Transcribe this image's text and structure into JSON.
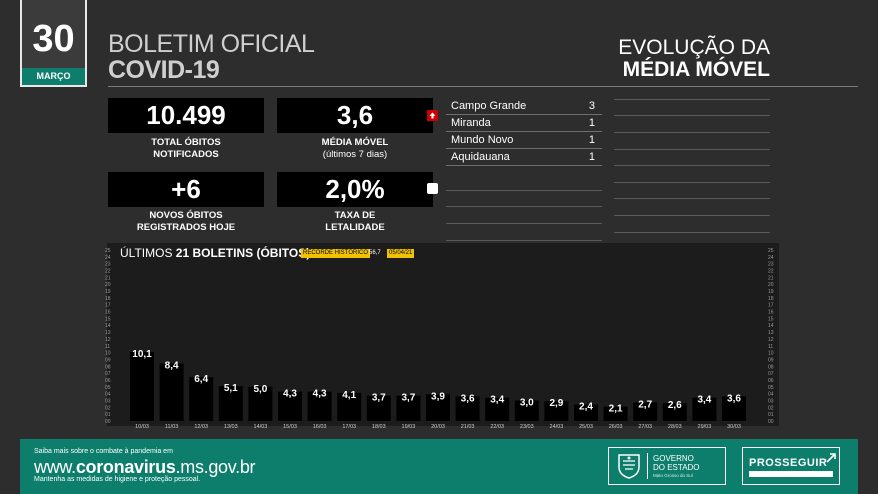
{
  "header": {
    "day": "30",
    "month": "MARÇO",
    "title_line1": "BOLETIM OFICIAL",
    "title_line2": "COVID-19",
    "section_line1": "EVOLUÇÃO DA",
    "section_line2": "MÉDIA MÓVEL"
  },
  "stats": {
    "total_deaths": {
      "value": "10.499",
      "label_line1": "TOTAL ÓBITOS",
      "label_line2": "NOTIFICADOS"
    },
    "moving_average": {
      "value": "3,6",
      "label_line1": "MÉDIA MÓVEL",
      "label_line2": "(últimos 7 dias)"
    },
    "new_deaths": {
      "value": "+6",
      "label_line1": "NOVOS ÓBITOS",
      "label_line2": "REGISTRADOS HOJE"
    },
    "lethality": {
      "value": "2,0%",
      "label_line1": "TAXA DE",
      "label_line2": "LETALIDADE"
    }
  },
  "cities": [
    {
      "name": "Campo Grande",
      "value": "3"
    },
    {
      "name": "Miranda",
      "value": "1"
    },
    {
      "name": "Mundo Novo",
      "value": "1"
    },
    {
      "name": "Aquidauana",
      "value": "1"
    }
  ],
  "chart_title": {
    "prefix": "ÚLTIMOS ",
    "bold": "21 BOLETINS (ÓBITOS)"
  },
  "legend": {
    "record_label": "RECORDE HISTÓRICO",
    "record_value": "56,7",
    "record_date": "05/04/21"
  },
  "chart_data": {
    "type": "bar",
    "categories": [
      "10/03",
      "11/03",
      "12/03",
      "13/03",
      "14/03",
      "15/03",
      "16/03",
      "17/03",
      "18/03",
      "19/03",
      "20/03",
      "21/03",
      "22/03",
      "23/03",
      "24/03",
      "25/03",
      "26/03",
      "27/03",
      "28/03",
      "29/03",
      "30/03"
    ],
    "values": [
      10.1,
      8.4,
      6.4,
      5.1,
      5.0,
      4.3,
      4.3,
      4.1,
      3.7,
      3.7,
      3.9,
      3.6,
      3.4,
      3.0,
      2.9,
      2.4,
      2.1,
      2.7,
      2.6,
      3.4,
      3.6
    ],
    "value_labels": [
      "10,1",
      "8,4",
      "6,4",
      "5,1",
      "5,0",
      "4,3",
      "4,3",
      "4,1",
      "3,7",
      "3,7",
      "3,9",
      "3,6",
      "3,4",
      "3,0",
      "2,9",
      "2,4",
      "2,1",
      "2,7",
      "2,6",
      "3,4",
      "3,6"
    ],
    "ylim": [
      0,
      25
    ],
    "yticks": [
      "00",
      "01",
      "02",
      "03",
      "04",
      "05",
      "06",
      "07",
      "08",
      "09",
      "10",
      "11",
      "12",
      "13",
      "14",
      "15",
      "16",
      "17",
      "18",
      "19",
      "20",
      "21",
      "22",
      "23",
      "24",
      "25"
    ],
    "bar_color": "#000000",
    "background": "#1c1c1c"
  },
  "footer": {
    "line1": "Saiba mais sobre o combate à pandemia em",
    "url_prefix": "www.",
    "url_bold": "coronavirus",
    "url_suffix": ".ms.gov.br",
    "line3": "Mantenha as medidas de higiene e proteção pessoal.",
    "gov_line1": "GOVERNO",
    "gov_line2": "DO ESTADO",
    "gov_line3": "Mato Grosso do Sul",
    "program": "PROSSEGUIR"
  },
  "colors": {
    "accent": "#0d7d6c",
    "record": "#f2c200",
    "alert": "#cc0000"
  }
}
